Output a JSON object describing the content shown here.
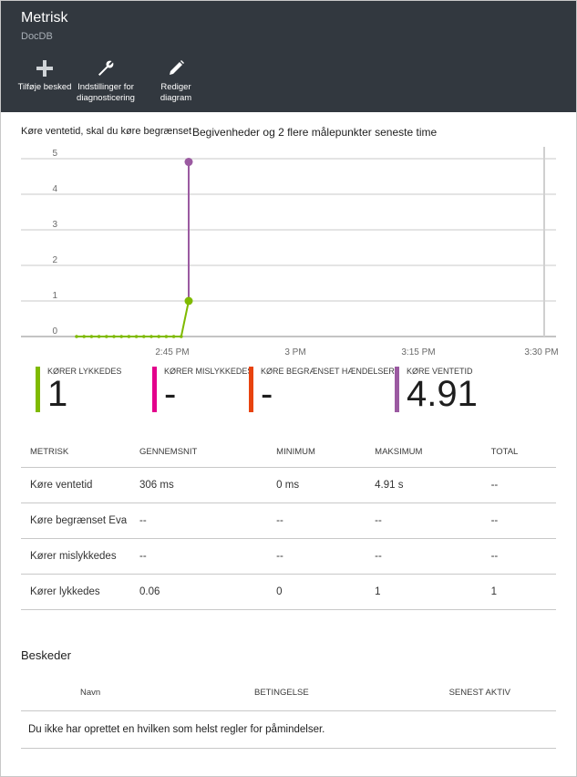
{
  "blade": {
    "title": "Metrisk",
    "subtitle": "DocDB"
  },
  "commands": [
    {
      "label": "Tilføje besked",
      "icon": "plus-icon"
    },
    {
      "label": "Indstillinger for\ndiagnosticering",
      "icon": "wrench-icon"
    },
    {
      "label": "Rediger diagram",
      "icon": "pencil-icon"
    }
  ],
  "chart": {
    "title_left": "Køre ventetid, skal du køre begrænset",
    "title_right": "Begivenheder og 2 flere målepunkter seneste time"
  },
  "chart_data": {
    "type": "line",
    "y_ticks": [
      "0",
      "1",
      "2",
      "3",
      "4",
      "5"
    ],
    "x_ticks": [
      "2:45 PM",
      "3 PM",
      "3:15 PM",
      "3:30 PM"
    ],
    "ylim": [
      0,
      5
    ],
    "grid": true,
    "series": [
      {
        "name": "KØRER LYKKEDES",
        "color": "#7fba00",
        "values": [
          0,
          0,
          0,
          0,
          0,
          0,
          0,
          0,
          0,
          0,
          0,
          0,
          0,
          0,
          0,
          1
        ]
      },
      {
        "name": "KØRE VENTETID",
        "color": "#9b5aa1",
        "values": [
          null,
          null,
          null,
          null,
          null,
          null,
          null,
          null,
          null,
          null,
          null,
          null,
          null,
          null,
          null,
          4.91
        ]
      }
    ]
  },
  "tiles": [
    {
      "label": "KØRER LYKKEDES",
      "value": "1",
      "color": "#7fba00"
    },
    {
      "label": "KØRER MISLYKKEDES",
      "value": "-",
      "color": "#e3008c"
    },
    {
      "label": "KØRE BEGRÆNSET HÆNDELSER",
      "value": "-",
      "color": "#e8430f"
    },
    {
      "label": "KØRE VENTETID",
      "value": "4.91",
      "color": "#9b5aa1"
    }
  ],
  "table": {
    "headers": [
      "METRISK",
      "GENNEMSNIT",
      "MINIMUM",
      "MAKSIMUM",
      "TOTAL"
    ],
    "rows": [
      [
        "Køre ventetid",
        "306 ms",
        "0 ms",
        "4.91 s",
        "--"
      ],
      [
        "Køre begrænset Eva",
        "--",
        "--",
        "--",
        "--"
      ],
      [
        "Kører mislykkedes",
        "--",
        "--",
        "--",
        "--"
      ],
      [
        "Kører lykkedes",
        "0.06",
        "0",
        "1",
        "1"
      ]
    ]
  },
  "alerts": {
    "title": "Beskeder",
    "headers": [
      "Navn",
      "BETINGELSE",
      "SENEST AKTIV"
    ],
    "empty_message": "Du ikke har oprettet en hvilken som helst regler for påmindelser."
  }
}
